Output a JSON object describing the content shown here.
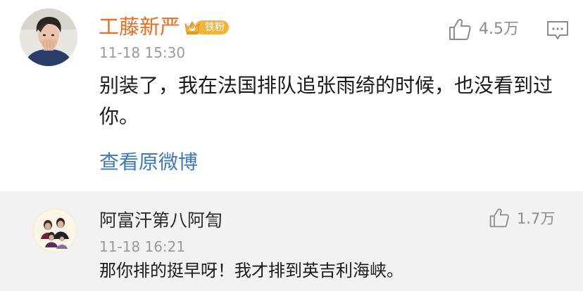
{
  "main_comment": {
    "username": "工藤新严",
    "fan_badge": {
      "level": "6",
      "label": "铁粉"
    },
    "timestamp": "11-18 15:30",
    "likes": "4.5万",
    "content": "别装了，我在法国排队追张雨绮的时候，也没看到过你。",
    "view_original_link": "查看原微博",
    "icons": {
      "like": "thumbs-up-icon",
      "comment": "comment-bubble-icon",
      "badge": "crown-badge-icon"
    }
  },
  "reply": {
    "username": "阿富汗第八阿訇",
    "timestamp": "11-18 16:21",
    "likes": "1.7万",
    "content": "那你排的挺早呀！我才排到英吉利海峡。",
    "icons": {
      "like": "thumbs-up-icon"
    }
  },
  "colors": {
    "username_vip": "#f26b1d",
    "link_blue": "#3f7ab8",
    "muted_gray": "#9a9a9a",
    "reply_background": "#f2f2f2",
    "badge_gold": "#f2b53a"
  }
}
